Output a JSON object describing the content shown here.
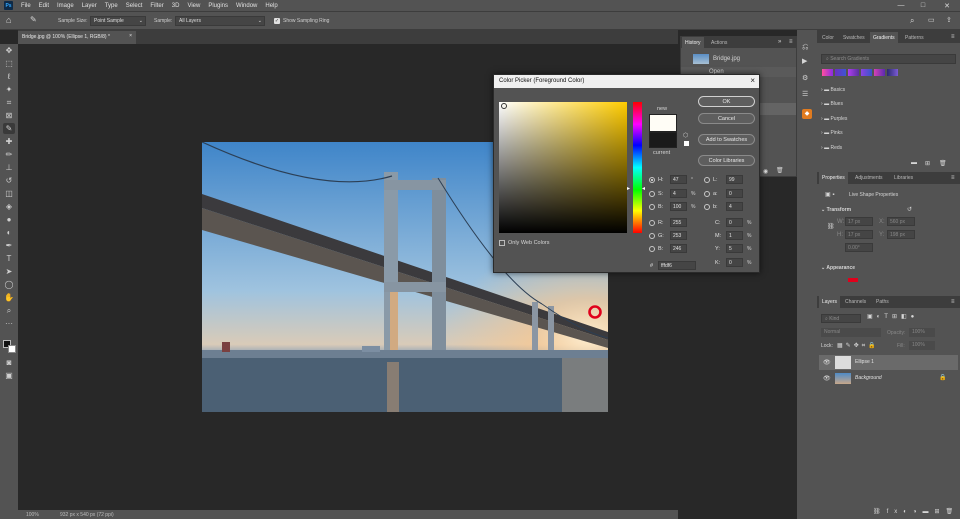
{
  "app": {
    "logo": "Ps"
  },
  "menu": [
    "File",
    "Edit",
    "Image",
    "Layer",
    "Type",
    "Select",
    "Filter",
    "3D",
    "View",
    "Plugins",
    "Window",
    "Help"
  ],
  "window_controls": {
    "minimize": "—",
    "maximize": "□",
    "close": "✕"
  },
  "options_bar": {
    "sample_size_label": "Sample Size:",
    "sample_size_value": "Point Sample",
    "sample_label": "Sample:",
    "sample_value": "All Layers",
    "show_ring_label": "Show Sampling Ring",
    "show_ring_checked": true
  },
  "document": {
    "tab_title": "Bridge.jpg @ 100% (Ellipse 1, RGB/8) *",
    "status_zoom": "100%",
    "status_info": "932 px x 540 px (72 ppi)"
  },
  "history_panel": {
    "tabs": [
      "History",
      "Actions"
    ],
    "items": [
      "Bridge.jpg",
      "Open"
    ]
  },
  "color_picker": {
    "title": "Color Picker (Foreground Color)",
    "new_label": "new",
    "current_label": "current",
    "new_color": "#fffdf6",
    "current_color": "#1a1a1a",
    "ok_label": "OK",
    "cancel_label": "Cancel",
    "add_swatches_label": "Add to Swatches",
    "color_libraries_label": "Color Libraries",
    "only_web_label": "Only Web Colors",
    "hex_label": "#",
    "hex_value": "fffdf6",
    "fields": {
      "H": {
        "label": "H:",
        "value": "47",
        "unit": "°"
      },
      "S": {
        "label": "S:",
        "value": "4",
        "unit": "%"
      },
      "B": {
        "label": "B:",
        "value": "100",
        "unit": "%"
      },
      "R": {
        "label": "R:",
        "value": "255"
      },
      "G": {
        "label": "G:",
        "value": "253"
      },
      "Bl": {
        "label": "B:",
        "value": "246"
      },
      "L": {
        "label": "L:",
        "value": "99"
      },
      "a": {
        "label": "a:",
        "value": "0"
      },
      "b": {
        "label": "b:",
        "value": "4"
      },
      "C": {
        "label": "C:",
        "value": "0",
        "unit": "%"
      },
      "M": {
        "label": "M:",
        "value": "1",
        "unit": "%"
      },
      "Y": {
        "label": "Y:",
        "value": "5",
        "unit": "%"
      },
      "K": {
        "label": "K:",
        "value": "0",
        "unit": "%"
      }
    }
  },
  "right_panel": {
    "top_tabs": [
      "Color",
      "Swatches",
      "Gradients",
      "Patterns"
    ],
    "active_top_tab": "Gradients",
    "search_placeholder": "Search Gradients",
    "gradient_folders": [
      "Basics",
      "Blues",
      "Purples",
      "Pinks",
      "Reds"
    ],
    "properties_tabs": [
      "Properties",
      "Adjustments",
      "Libraries"
    ],
    "properties_title": "Live Shape Properties",
    "transform_label": "Transform",
    "transform_fields": {
      "w": "W:",
      "h": "H:",
      "x": "X:",
      "y": "Y:",
      "w_val": "17 px",
      "h_val": "17 px",
      "x_val": "560 px",
      "y_val": "198 px",
      "angle": "0.00°"
    },
    "appearance_label": "Appearance",
    "layers_tabs": [
      "Layers",
      "Channels",
      "Paths"
    ],
    "kind_placeholder": "Kind",
    "blend_mode": "Normal",
    "opacity_label": "Opacity:",
    "opacity_value": "100%",
    "lock_label": "Lock:",
    "fill_label": "Fill:",
    "fill_value": "100%",
    "layers": [
      {
        "name": "Ellipse 1"
      },
      {
        "name": "Background"
      }
    ]
  }
}
